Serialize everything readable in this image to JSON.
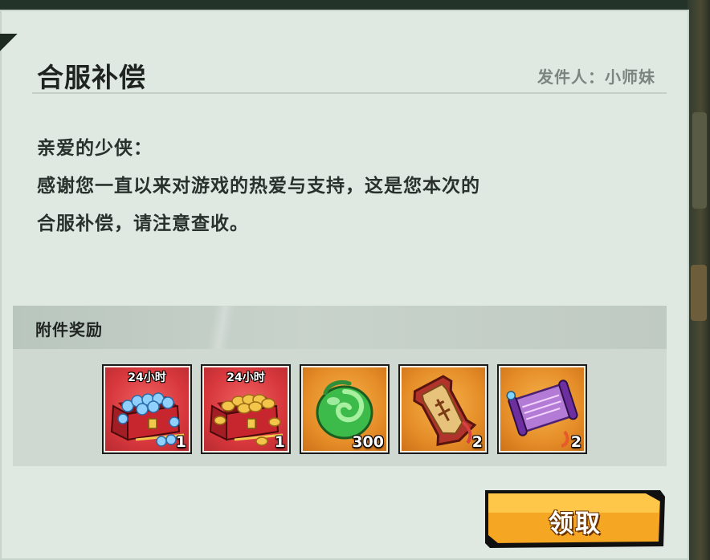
{
  "mail": {
    "title": "合服补偿",
    "sender_label": "发件人：",
    "sender_name": "小师妹",
    "greeting": "亲爱的少侠：",
    "body_line1": "感谢您一直以来对游戏的热爱与支持，这是您本次的",
    "body_line2": "合服补偿，请注意查收。"
  },
  "attachments": {
    "title": "附件奖励",
    "items": [
      {
        "icon": "blue-gem-chest-icon",
        "tag": "24小时",
        "count": "1"
      },
      {
        "icon": "gold-coin-chest-icon",
        "tag": "24小时",
        "count": "1"
      },
      {
        "icon": "green-jade-icon",
        "tag": "",
        "count": "300"
      },
      {
        "icon": "token-plaque-icon",
        "tag": "",
        "count": "2"
      },
      {
        "icon": "purple-scroll-icon",
        "tag": "",
        "count": "2"
      }
    ]
  },
  "claim_button": {
    "label": "领取"
  },
  "colors": {
    "panel_bg": "#dfe9e2",
    "button_orange": "#f5a623",
    "item_red": "#d7373c",
    "item_orange": "#e58d28"
  }
}
